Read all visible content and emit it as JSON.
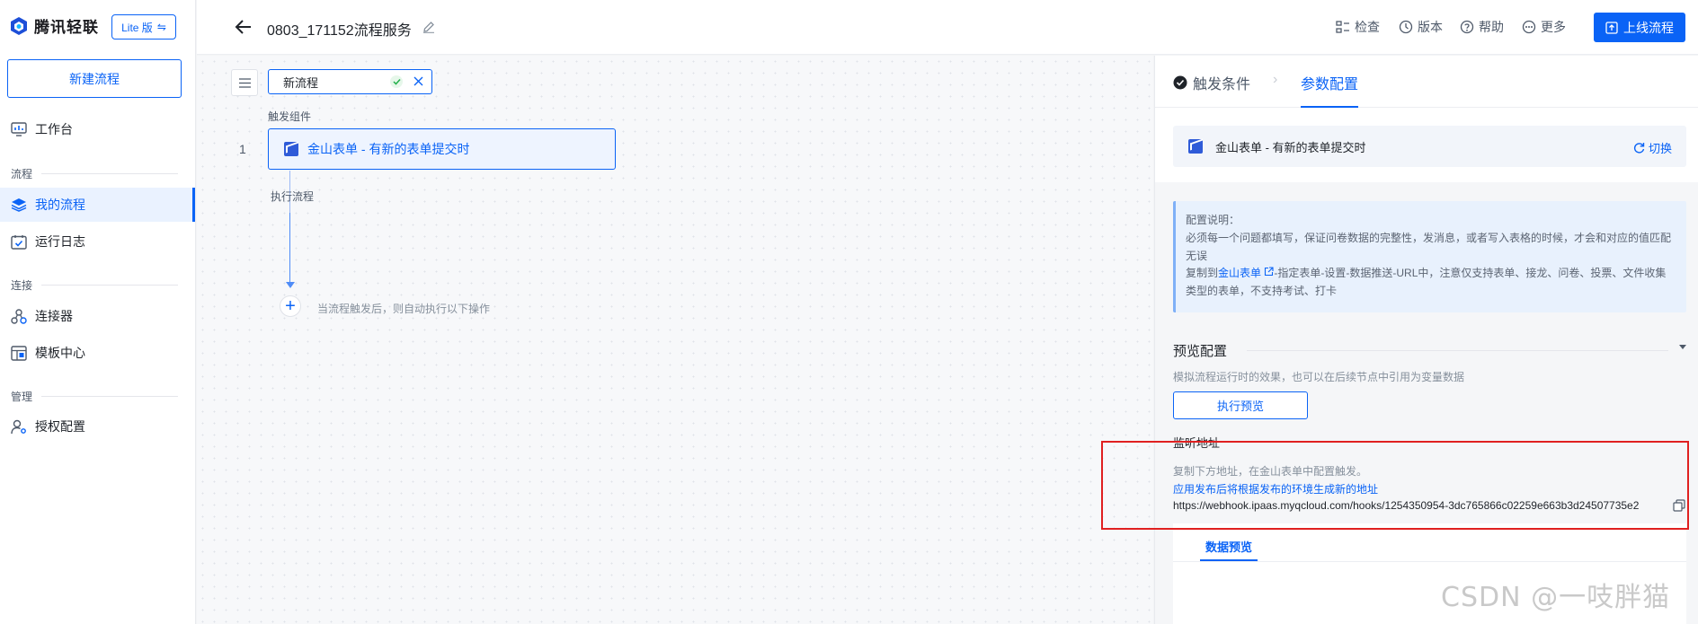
{
  "app": {
    "logo_text": "腾讯轻联",
    "edition_label": "Lite 版",
    "new_flow_label": "新建流程"
  },
  "sidebar": {
    "workbench": "工作台",
    "groups": {
      "flow": "流程",
      "connect": "连接",
      "manage": "管理"
    },
    "items": {
      "my_flows": "我的流程",
      "run_logs": "运行日志",
      "connectors": "连接器",
      "templates": "模板中心",
      "auth": "授权配置"
    }
  },
  "topbar": {
    "flow_title": "0803_171152流程服务",
    "check": "检查",
    "version": "版本",
    "help": "帮助",
    "more": "更多",
    "publish": "上线流程"
  },
  "canvas": {
    "flow_name_value": "新流程",
    "trigger_section": "触发组件",
    "step_number": "1",
    "trigger_name": "金山表单 - 有新的表单提交时",
    "exec_section": "执行流程",
    "add_hint": "当流程触发后，则自动执行以下操作"
  },
  "panel": {
    "tab_trigger": "触发条件",
    "tab_params": "参数配置",
    "trigger_name": "金山表单 - 有新的表单提交时",
    "switch_label": "切换",
    "info": {
      "line1": "配置说明：",
      "line2": "必须每一个问题都填写，保证问卷数据的完整性，发消息，或者写入表格的时候，才会和对应的值匹配",
      "line3": "无误",
      "line4_prefix": "复制到",
      "line4_link": "金山表单",
      "line4_suffix": "-指定表单-设置-数据推送-URL中，注意仅支持表单、接龙、问卷、投票、文件收集",
      "line5": "类型的表单，不支持考试、打卡"
    },
    "preview_section": "预览配置",
    "preview_desc": "模拟流程运行时的效果，也可以在后续节点中引用为变量数据",
    "preview_button": "执行预览",
    "listen_title": "监听地址",
    "copy_desc": "复制下方地址，在金山表单中配置触发。",
    "publish_note": "应用发布后将根据发布的环境生成新的地址",
    "webhook_url": "https://webhook.ipaas.myqcloud.com/hooks/1254350954-3dc765866c02259e663b3d24507735e2",
    "data_preview_tab": "数据预览"
  },
  "watermark": "CSDN @一吱胖猫",
  "colors": {
    "accent": "#0a63f6",
    "highlight": "#e02020"
  }
}
